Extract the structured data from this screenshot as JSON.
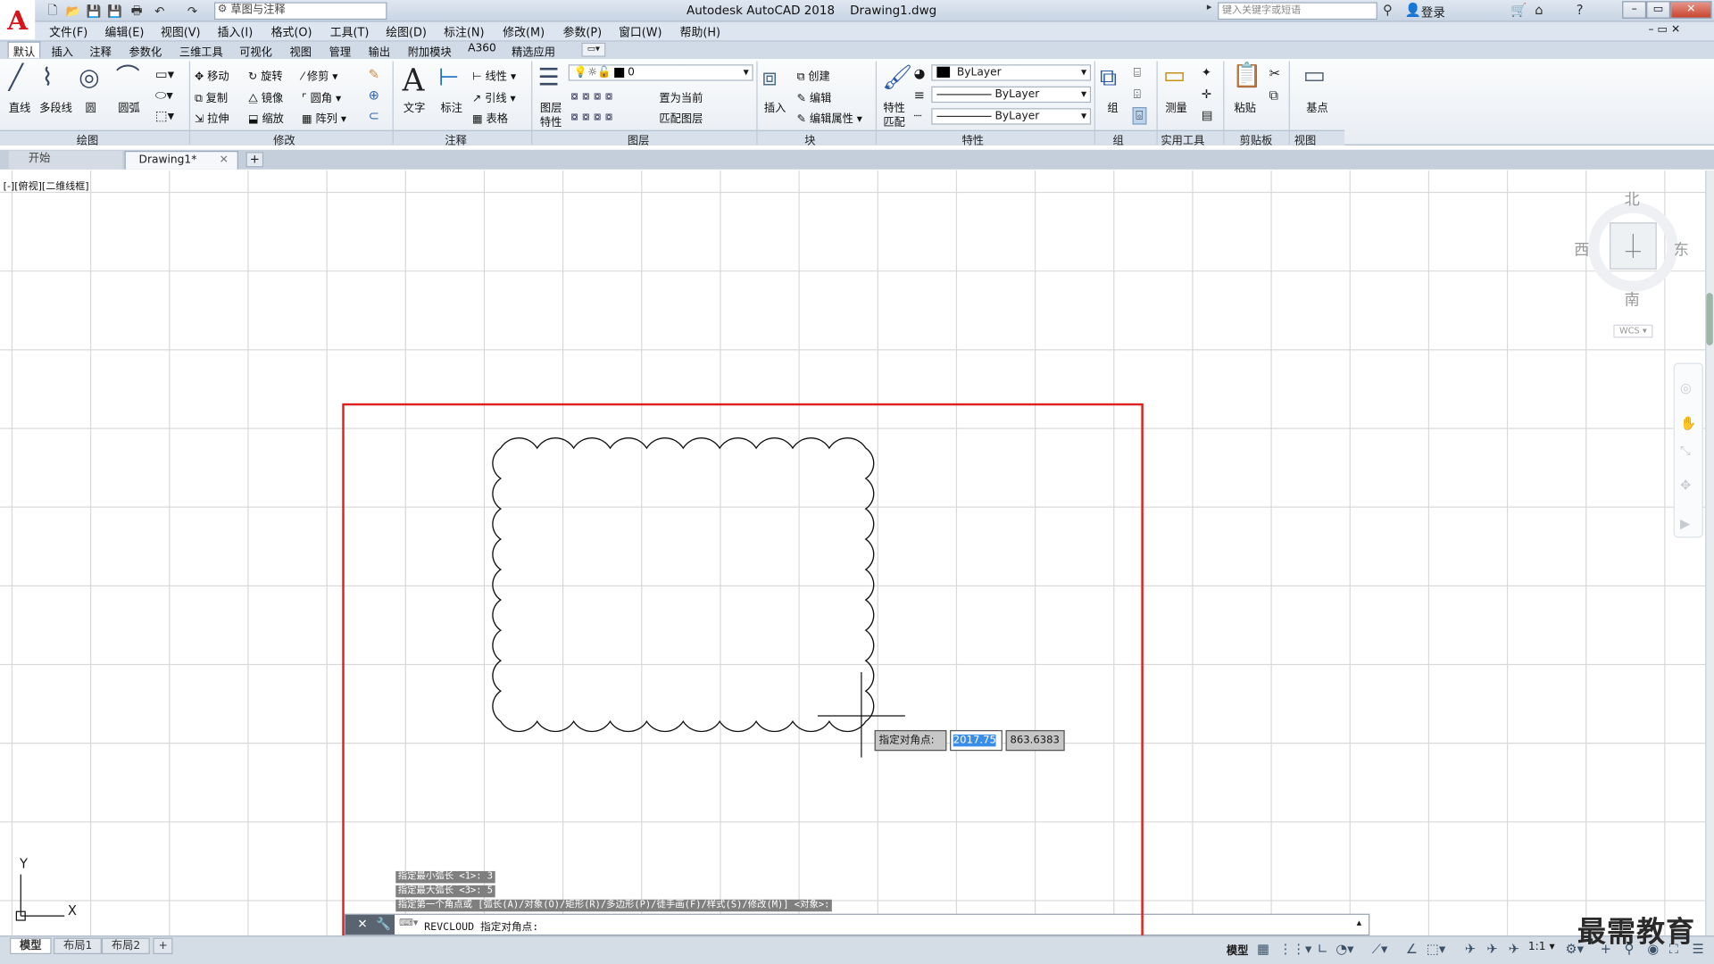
{
  "title_bar": {
    "app_title": "Autodesk AutoCAD 2018",
    "file_name": "Drawing1.dwg",
    "workspace": "草图与注释",
    "search_placeholder": "键入关键字或短语",
    "login": "登录"
  },
  "menu": [
    "文件(F)",
    "编辑(E)",
    "视图(V)",
    "插入(I)",
    "格式(O)",
    "工具(T)",
    "绘图(D)",
    "标注(N)",
    "修改(M)",
    "参数(P)",
    "窗口(W)",
    "帮助(H)"
  ],
  "ribbon_tabs": [
    "默认",
    "插入",
    "注释",
    "参数化",
    "三维工具",
    "可视化",
    "视图",
    "管理",
    "输出",
    "附加模块",
    "A360",
    "精选应用"
  ],
  "ribbon": {
    "draw": {
      "line": "直线",
      "polyline": "多段线",
      "circle": "圆",
      "arc": "圆弧",
      "panel": "绘图"
    },
    "modify": {
      "move": "移动",
      "rotate": "旋转",
      "trim": "修剪",
      "copy": "复制",
      "mirror": "镜像",
      "fillet": "圆角",
      "stretch": "拉伸",
      "scale": "缩放",
      "array": "阵列",
      "panel": "修改"
    },
    "annotation": {
      "text": "文字",
      "dimension": "标注",
      "linear": "线性",
      "leader": "引线",
      "table": "表格",
      "panel": "注释"
    },
    "layers": {
      "properties_line1": "图层",
      "properties_line2": "特性",
      "layer_value": "0",
      "set_current": "置为当前",
      "match_layer": "匹配图层",
      "panel": "图层"
    },
    "block": {
      "insert": "插入",
      "create": "创建",
      "edit": "编辑",
      "edit_attr": "编辑属性",
      "panel": "块"
    },
    "properties": {
      "match_line1": "特性",
      "match_line2": "匹配",
      "color": "ByLayer",
      "linetype": "ByLayer",
      "lineweight": "ByLayer",
      "panel": "特性"
    },
    "group": {
      "group": "组",
      "panel": "组"
    },
    "utilities": {
      "measure": "测量",
      "panel": "实用工具"
    },
    "clipboard": {
      "paste": "粘贴",
      "panel": "剪贴板"
    },
    "view": {
      "base": "基点",
      "panel": "视图"
    }
  },
  "doc_tabs": {
    "start": "开始",
    "drawing": "Drawing1*"
  },
  "viewport_label": "[-][俯视][二维线框]",
  "viewcube": {
    "north": "北",
    "south": "南",
    "east": "东",
    "west": "西",
    "wcs": "WCS"
  },
  "ucs": {
    "x": "X",
    "y": "Y"
  },
  "dynamic_input": {
    "label": "指定对角点:",
    "x_value": "2017.75",
    "y_value": "863.6383"
  },
  "command_history": [
    "指定最小弧长 <1>: 3",
    "指定最大弧长 <3>: 5",
    "指定第一个角点或 [弧长(A)/对象(O)/矩形(R)/多边形(P)/徒手画(F)/样式(S)/修改(M)] <对象>:"
  ],
  "command_input": "REVCLOUD 指定对角点:",
  "layout_tabs": [
    "模型",
    "布局1",
    "布局2"
  ],
  "status": {
    "model": "模型",
    "scale": "1:1"
  },
  "watermark": "最需教育",
  "colors": {
    "highlight_box": "#e02020",
    "grid": "#d9d9d9",
    "ribbon_bg": "#f0f3f7"
  }
}
